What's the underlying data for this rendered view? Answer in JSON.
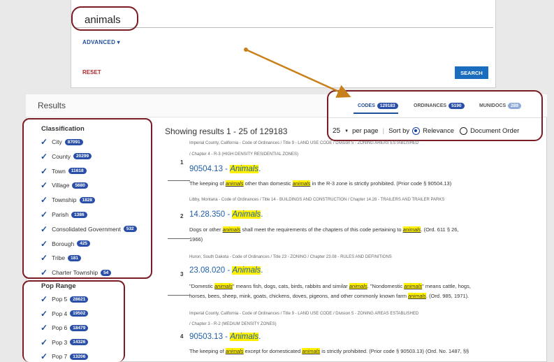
{
  "search": {
    "query": "animals",
    "advanced_label": "ADVANCED ▾",
    "reset_label": "RESET",
    "search_label": "SEARCH"
  },
  "results": {
    "title": "Results",
    "showing": "Showing results 1 - 25 of 129183",
    "per_page_value": "25",
    "per_page_label": "per page",
    "sort_label": "Sort by",
    "sort_options": [
      "Relevance",
      "Document Order"
    ],
    "sort_selected": "Relevance"
  },
  "tabs": [
    {
      "label": "CODES",
      "count": "129183"
    },
    {
      "label": "ORDINANCES",
      "count": "5190"
    },
    {
      "label": "MUNIDOCS",
      "count": "289"
    }
  ],
  "classification": {
    "title": "Classification",
    "items": [
      {
        "label": "City",
        "count": "87091"
      },
      {
        "label": "County",
        "count": "20299"
      },
      {
        "label": "Town",
        "count": "11618"
      },
      {
        "label": "Village",
        "count": "5680"
      },
      {
        "label": "Township",
        "count": "1828"
      },
      {
        "label": "Parish",
        "count": "1386"
      },
      {
        "label": "Consolidated Government",
        "count": "532"
      },
      {
        "label": "Borough",
        "count": "425"
      },
      {
        "label": "Tribe",
        "count": "181"
      },
      {
        "label": "Charter Township",
        "count": "54"
      }
    ]
  },
  "pop_range": {
    "title": "Pop Range",
    "items": [
      {
        "label": "Pop 5",
        "count": "28621"
      },
      {
        "label": "Pop 4",
        "count": "19502"
      },
      {
        "label": "Pop 6",
        "count": "18479"
      },
      {
        "label": "Pop 3",
        "count": "14326"
      },
      {
        "label": "Pop 7",
        "count": "13206"
      }
    ]
  },
  "result_items": [
    {
      "num": "1",
      "crumb1": "Imperial County, California - Code of Ordinances  /  Title 9 - LAND USE CODE  /  Division 5 - ZONING AREAS ESTABLISHED",
      "crumb2": "/  Chapter 4 - R-3 (HIGH DENSITY RESIDENTIAL ZONES)",
      "code": "90504.13 - ",
      "code_hl": "Animals",
      "code_end": ".",
      "snippet": [
        "The keeping of ",
        "animals",
        " other than domestic ",
        "animals",
        " in the R-3 zone is strictly prohibited. (Prior code § 90504.13)"
      ]
    },
    {
      "num": "2",
      "crumb1": "Libby, Montana - Code of Ordinances  /  Title 14 - BUILDINGS AND CONSTRUCTION  /  Chapter 14.28 - TRAILERS AND TRAILER PARKS",
      "code": "14.28.350 - ",
      "code_hl": "Animals",
      "code_end": ".",
      "snippet": [
        "Dogs or other ",
        "animals",
        " shall meet the requirements of the chapters of this code pertaining to ",
        "animals",
        ". (Ord. 611 § 26,"
      ],
      "snippet2": "1966)"
    },
    {
      "num": "3",
      "crumb1": "Huron, South Dakota - Code of Ordinances  /  Title 23 - ZONING  /  Chapter 23.08 - RULES AND DEFINITIONS",
      "code": "23.08.020 - ",
      "code_hl": "Animals",
      "code_end": ".",
      "snippet": [
        "\"Domestic ",
        "animals",
        "\" means fish, dogs, cats, birds, rabbits and similar ",
        "animals",
        ". \"Nondomestic ",
        "animals",
        "\" means cattle, hogs,"
      ],
      "snippet2_parts": [
        "horses, bees, sheep, mink, goats, chickens, doves, pigeons, and other commonly known farm ",
        "animals",
        ". (Ord. 985, 1971)."
      ]
    },
    {
      "num": "4",
      "crumb1": "Imperial County, California - Code of Ordinances  /  Title 9 - LAND USE CODE  /  Division 5 - ZONING AREAS ESTABLISHED",
      "crumb2": "/  Chapter 3 - R-2 (MEDIUM DENSITY ZONES)",
      "code": "90503.13 - ",
      "code_hl": "Animals",
      "code_end": ".",
      "snippet": [
        "The keeping of ",
        "animals",
        " except for domesticated ",
        "animals",
        " is strictly prohibited. (Prior code § 90503.13) (Ord. No. 1487, §§"
      ]
    }
  ],
  "colors": {
    "accent": "#1f4e9a",
    "badge": "#2a4fa8",
    "highlight": "#fff000",
    "annotation": "#7a1c24",
    "arrow": "#c8811a"
  }
}
